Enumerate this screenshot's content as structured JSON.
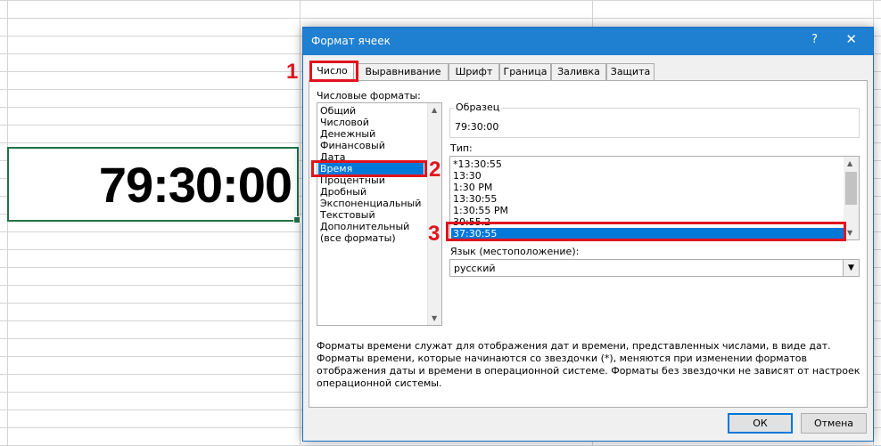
{
  "cell": {
    "value": "79:30:00"
  },
  "dialog": {
    "title": "Формат ячеек",
    "help_glyph": "?",
    "close_glyph": "✕",
    "tabs": [
      "Число",
      "Выравнивание",
      "Шрифт",
      "Граница",
      "Заливка",
      "Защита"
    ],
    "active_tab": "Число",
    "formats_label": "Числовые форматы:",
    "formats": [
      "Общий",
      "Числовой",
      "Денежный",
      "Финансовый",
      "Дата",
      "Время",
      "Процентный",
      "Дробный",
      "Экспоненциальный",
      "Текстовый",
      "Дополнительный",
      "(все форматы)"
    ],
    "selected_format": "Время",
    "sample_label": "Образец",
    "sample_value": "79:30:00",
    "type_label": "Тип:",
    "types": [
      "*13:30:55",
      "13:30",
      "1:30 PM",
      "13:30:55",
      "1:30:55 PM",
      "30:55.2",
      "37:30:55"
    ],
    "selected_type": "37:30:55",
    "language_label": "Язык (местоположение):",
    "language_value": "русский",
    "description": "Форматы времени служат для отображения дат и времени, представленных числами, в виде дат. Форматы времени, которые начинаются со звездочки (*), меняются при изменении форматов отображения даты и времени в операционной системе. Форматы без звездочки не зависят от настроек операционной системы.",
    "ok_label": "ОК",
    "cancel_label": "Отмена"
  },
  "annotations": [
    "1",
    "2",
    "3"
  ],
  "colors": {
    "title_bar": "#1f7fd0",
    "selection": "#0078d7",
    "annotation": "#e0141e",
    "cell_border": "#217346"
  },
  "icons": [
    "help-icon",
    "close-icon",
    "scroll-up-icon",
    "scroll-down-icon",
    "dropdown-arrow-icon"
  ]
}
